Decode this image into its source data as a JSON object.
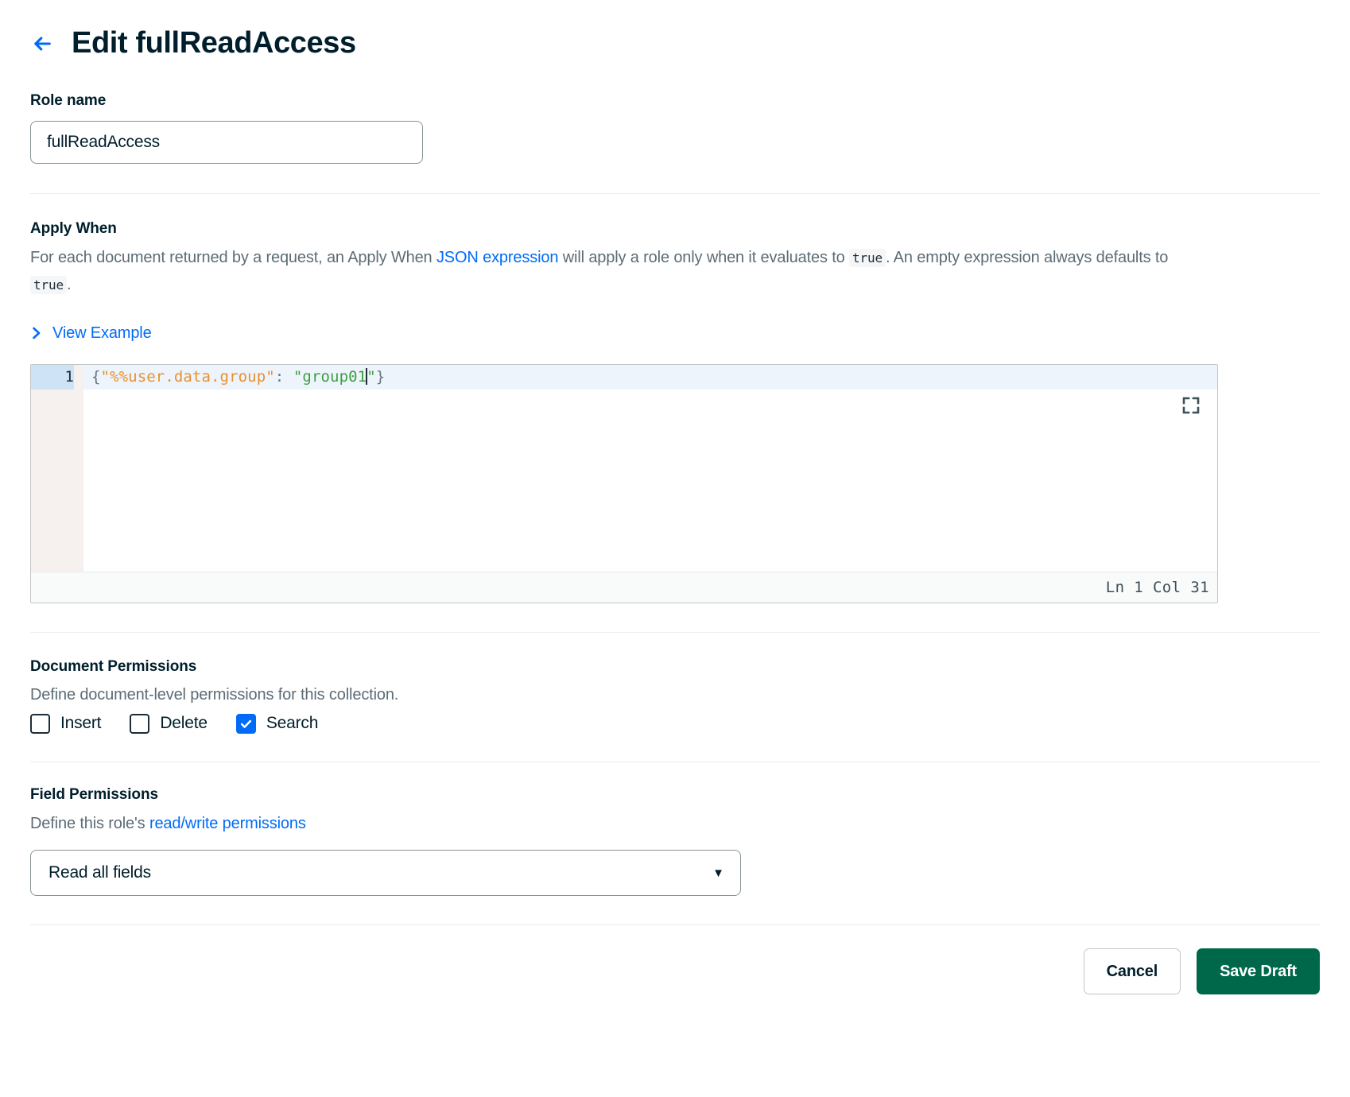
{
  "header": {
    "back_icon": "arrow-left-icon",
    "title": "Edit fullReadAccess"
  },
  "role_name": {
    "label": "Role name",
    "value": "fullReadAccess",
    "placeholder": "Role name"
  },
  "apply_when": {
    "label": "Apply When",
    "desc_part1": "For each document returned by a request, an Apply When ",
    "desc_link": "JSON expression",
    "desc_part2": " will apply a role only when it evaluates to ",
    "desc_code1": "true",
    "desc_part3": ". An empty expression always defaults to ",
    "desc_code2": "true",
    "desc_part4": ".",
    "view_example_label": "View Example",
    "chevron_icon": "chevron-right-icon"
  },
  "editor": {
    "line_number": "1",
    "code": {
      "open_brace": "{",
      "key": "\"%%user.data.group\"",
      "colon": ": ",
      "value": "\"group01",
      "value_end": "\"",
      "close_brace": "}"
    },
    "expand_icon": "expand-fullscreen-icon",
    "status": "Ln 1 Col 31"
  },
  "document_permissions": {
    "label": "Document Permissions",
    "description": "Define document-level permissions for this collection.",
    "checkboxes": [
      {
        "label": "Insert",
        "checked": false
      },
      {
        "label": "Delete",
        "checked": false
      },
      {
        "label": "Search",
        "checked": true
      }
    ]
  },
  "field_permissions": {
    "label": "Field Permissions",
    "desc_part1": "Define this role's ",
    "desc_link": "read/write permissions",
    "select_value": "Read all fields",
    "caret_icon": "chevron-down-icon"
  },
  "footer": {
    "cancel_label": "Cancel",
    "save_label": "Save Draft"
  },
  "colors": {
    "accent_blue": "#016bf8",
    "save_green": "#00684a",
    "text_dark": "#001e2b",
    "text_muted": "#5c6c75",
    "code_key_orange": "#e8912d",
    "code_value_green": "#3d9e40"
  }
}
